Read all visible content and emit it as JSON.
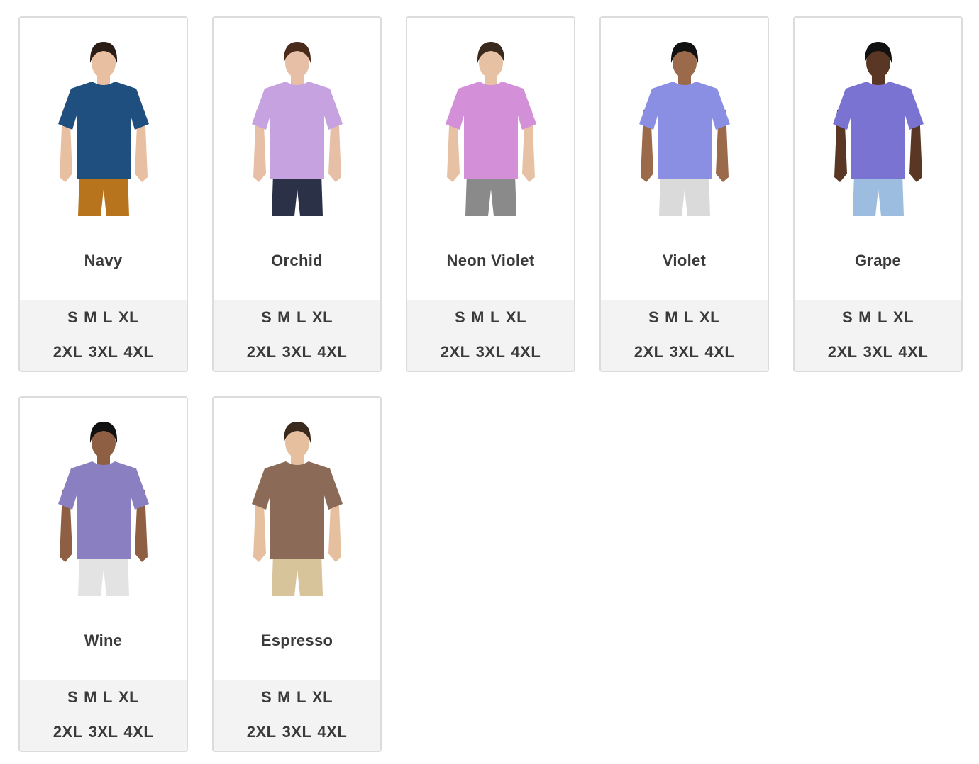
{
  "products": [
    {
      "color_name": "Navy",
      "shirt_color": "#1f4f7f",
      "pants_color": "#b8741d",
      "skin_color": "#e8bfa0",
      "hair_color": "#2a1d16",
      "sizes_row1": [
        "S",
        "M",
        "L",
        "XL"
      ],
      "sizes_row2": [
        "2XL",
        "3XL",
        "4XL"
      ]
    },
    {
      "color_name": "Orchid",
      "shirt_color": "#c7a2e0",
      "pants_color": "#2b3146",
      "skin_color": "#e7bfa6",
      "hair_color": "#4a2a1a",
      "sizes_row1": [
        "S",
        "M",
        "L",
        "XL"
      ],
      "sizes_row2": [
        "2XL",
        "3XL",
        "4XL"
      ]
    },
    {
      "color_name": "Neon Violet",
      "shirt_color": "#d38fd8",
      "pants_color": "#8a8a8a",
      "skin_color": "#e7c1a4",
      "hair_color": "#3a2a1e",
      "sizes_row1": [
        "S",
        "M",
        "L",
        "XL"
      ],
      "sizes_row2": [
        "2XL",
        "3XL",
        "4XL"
      ]
    },
    {
      "color_name": "Violet",
      "shirt_color": "#8a8fe3",
      "pants_color": "#dadada",
      "skin_color": "#9b6a4a",
      "hair_color": "#111111",
      "sizes_row1": [
        "S",
        "M",
        "L",
        "XL"
      ],
      "sizes_row2": [
        "2XL",
        "3XL",
        "4XL"
      ]
    },
    {
      "color_name": "Grape",
      "shirt_color": "#7a73d2",
      "pants_color": "#9dbde0",
      "skin_color": "#5a3724",
      "hair_color": "#111111",
      "sizes_row1": [
        "S",
        "M",
        "L",
        "XL"
      ],
      "sizes_row2": [
        "2XL",
        "3XL",
        "4XL"
      ]
    },
    {
      "color_name": "Wine",
      "shirt_color": "#8a7fc0",
      "pants_color": "#e3e3e3",
      "skin_color": "#8e5f42",
      "hair_color": "#111111",
      "sizes_row1": [
        "S",
        "M",
        "L",
        "XL"
      ],
      "sizes_row2": [
        "2XL",
        "3XL",
        "4XL"
      ]
    },
    {
      "color_name": "Espresso",
      "shirt_color": "#8b6b58",
      "pants_color": "#d8c49a",
      "skin_color": "#e6bf9f",
      "hair_color": "#3a2a1e",
      "sizes_row1": [
        "S",
        "M",
        "L",
        "XL"
      ],
      "sizes_row2": [
        "2XL",
        "3XL",
        "4XL"
      ]
    }
  ]
}
